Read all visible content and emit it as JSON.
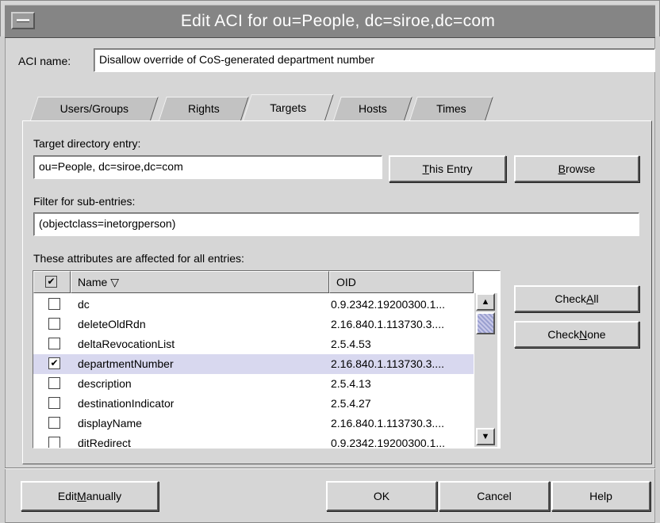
{
  "window": {
    "title": "Edit ACI for ou=People, dc=siroe,dc=com"
  },
  "aci": {
    "label": "ACI name:",
    "value": "Disallow override of CoS-generated department number"
  },
  "tabs": [
    {
      "label": "Users/Groups"
    },
    {
      "label": "Rights"
    },
    {
      "label": "Targets"
    },
    {
      "label": "Hosts"
    },
    {
      "label": "Times"
    }
  ],
  "active_tab": "Targets",
  "target": {
    "label": "Target directory entry:",
    "value": "ou=People, dc=siroe,dc=com",
    "this_entry_pre": "",
    "this_entry_u": "T",
    "this_entry_post": "his Entry",
    "browse_pre": "",
    "browse_u": "B",
    "browse_post": "rowse"
  },
  "filter": {
    "label": "Filter for sub-entries:",
    "value": "(objectclass=inetorgperson)"
  },
  "attributes": {
    "label": "These attributes are affected for all entries:",
    "header_check": "✔",
    "col_name": "Name ▽",
    "col_oid": "OID",
    "rows": [
      {
        "name": "dc",
        "oid": "0.9.2342.19200300.1...",
        "checked": ""
      },
      {
        "name": "deleteOldRdn",
        "oid": "2.16.840.1.113730.3....",
        "checked": ""
      },
      {
        "name": "deltaRevocationList",
        "oid": "2.5.4.53",
        "checked": ""
      },
      {
        "name": "departmentNumber",
        "oid": "2.16.840.1.113730.3....",
        "checked": "✔"
      },
      {
        "name": "description",
        "oid": "2.5.4.13",
        "checked": ""
      },
      {
        "name": "destinationIndicator",
        "oid": "2.5.4.27",
        "checked": ""
      },
      {
        "name": "displayName",
        "oid": "2.16.840.1.113730.3....",
        "checked": ""
      },
      {
        "name": "ditRedirect",
        "oid": "0.9.2342.19200300.1...",
        "checked": ""
      }
    ],
    "scroll_up": "▲",
    "scroll_down": "▼",
    "check_all_pre": "Check ",
    "check_all_u": "A",
    "check_all_post": "ll",
    "check_none_pre": "Check ",
    "check_none_u": "N",
    "check_none_post": "one"
  },
  "buttons": {
    "edit_pre": "Edit ",
    "edit_u": "M",
    "edit_post": "anually",
    "ok": "OK",
    "cancel": "Cancel",
    "help": "Help"
  },
  "icons": {
    "system_menu": "system-menu-icon",
    "sort": "sort-descending-icon"
  }
}
